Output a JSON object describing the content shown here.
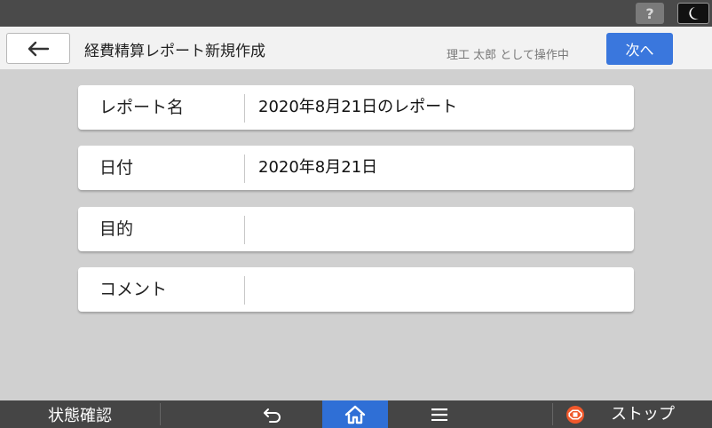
{
  "system_bar": {
    "help_label": "?"
  },
  "header": {
    "title": "経費精算レポート新規作成",
    "user_status": "理工 太郎 として操作中",
    "next_label": "次へ"
  },
  "form": {
    "fields": [
      {
        "label": "レポート名",
        "value": "2020年8月21日のレポート"
      },
      {
        "label": "日付",
        "value": "2020年8月21日"
      },
      {
        "label": "目的",
        "value": ""
      },
      {
        "label": "コメント",
        "value": ""
      }
    ]
  },
  "bottom_bar": {
    "status_check_label": "状態確認",
    "stop_label": "ストップ"
  },
  "colors": {
    "accent_blue": "#3a77dd",
    "home_blue": "#2f6fd6",
    "stop_orange": "#f0582b"
  }
}
